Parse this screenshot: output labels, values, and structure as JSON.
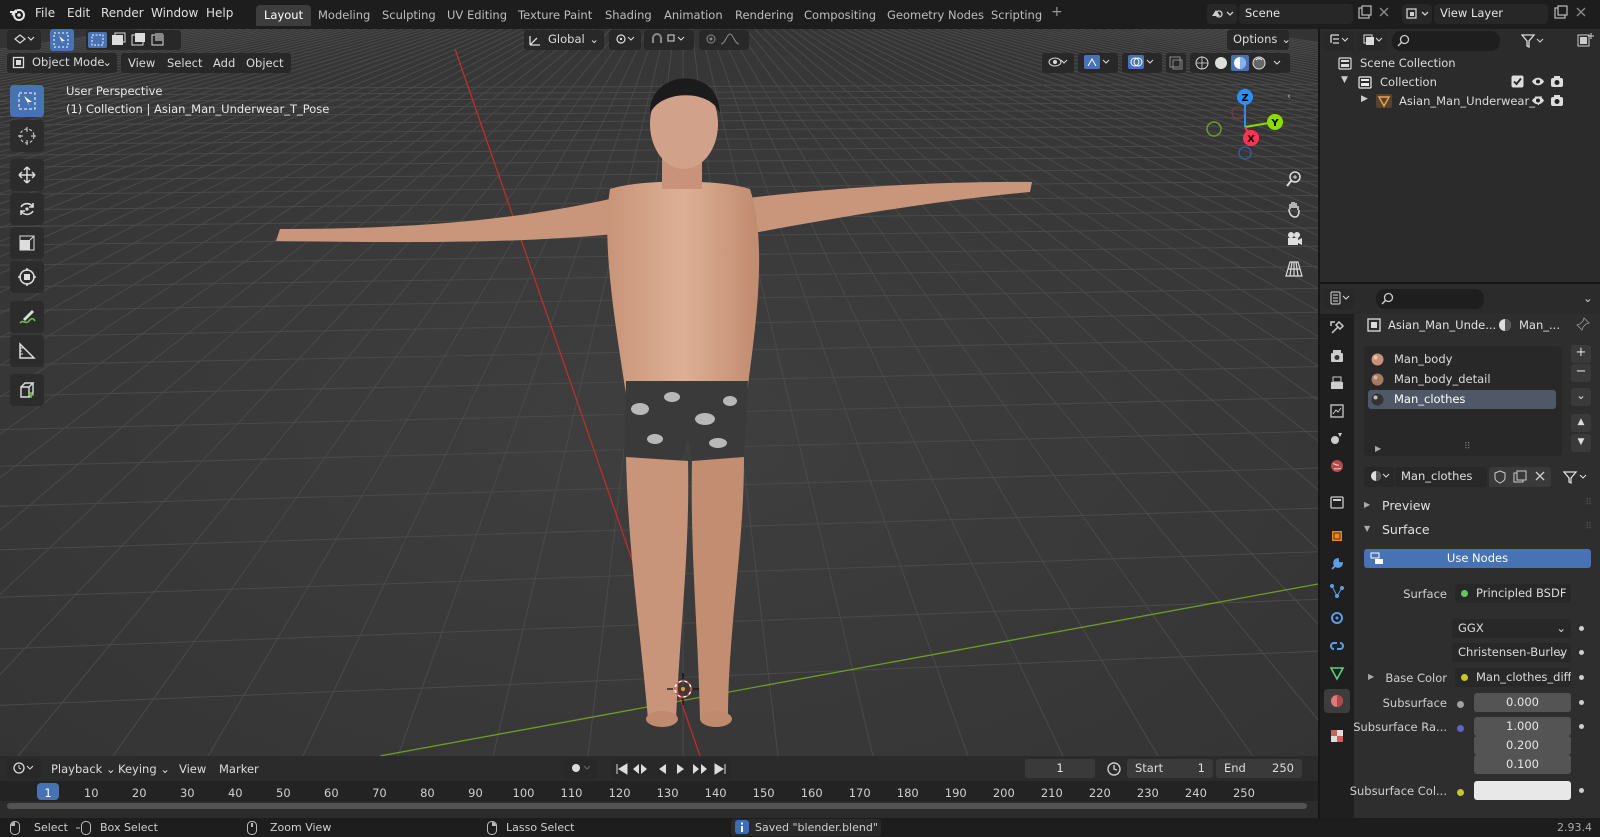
{
  "topbar": {
    "menus": [
      "File",
      "Edit",
      "Render",
      "Window",
      "Help"
    ],
    "workspaces": [
      "Layout",
      "Modeling",
      "Sculpting",
      "UV Editing",
      "Texture Paint",
      "Shading",
      "Animation",
      "Rendering",
      "Compositing",
      "Geometry Nodes",
      "Scripting"
    ],
    "add_tab": "+",
    "scene": "Scene",
    "view_layer": "View Layer"
  },
  "viewport_header": {
    "transform_orientation": "Global",
    "options": "Options",
    "mode": "Object Mode",
    "menus": [
      "View",
      "Select",
      "Add",
      "Object"
    ]
  },
  "viewport": {
    "perspective": "User Perspective",
    "collection_info": "(1) Collection | Asian_Man_Underwear_T_Pose",
    "gizmo": {
      "x": "X",
      "y": "Y",
      "z": "Z"
    }
  },
  "timeline": {
    "menus": [
      "Playback",
      "Keying",
      "View",
      "Marker"
    ],
    "current_frame": "1",
    "start_label": "Start",
    "start": "1",
    "end_label": "End",
    "end": "250",
    "frames": [
      "1",
      "10",
      "20",
      "30",
      "40",
      "50",
      "60",
      "70",
      "80",
      "90",
      "100",
      "110",
      "120",
      "130",
      "140",
      "150",
      "160",
      "170",
      "180",
      "190",
      "200",
      "210",
      "220",
      "230",
      "240",
      "250"
    ]
  },
  "statusbar": {
    "select": "Select",
    "box_select": "Box Select",
    "zoom_view": "Zoom View",
    "lasso_select": "Lasso Select",
    "message": "Saved \"blender.blend\"",
    "version": "2.93.4"
  },
  "outliner": {
    "scene_collection": "Scene Collection",
    "collection": "Collection",
    "object": "Asian_Man_Underwear_T"
  },
  "properties": {
    "object_name": "Asian_Man_Unde...",
    "material_short": "Man_...",
    "slots": [
      "Man_body",
      "Man_body_detail",
      "Man_clothes"
    ],
    "material_name": "Man_clothes",
    "panel_preview": "Preview",
    "panel_surface": "Surface",
    "use_nodes": "Use Nodes",
    "surface_label": "Surface",
    "surface_value": "Principled BSDF",
    "distribution": "GGX",
    "subsurface_method": "Christensen-Burley",
    "base_color_label": "Base Color",
    "base_color_value": "Man_clothes_diffus...",
    "subsurface_label": "Subsurface",
    "subsurface_value": "0.000",
    "subsurface_radius_label": "Subsurface Ra...",
    "subsurface_radius": [
      "1.000",
      "0.200",
      "0.100"
    ],
    "subsurface_color_label": "Subsurface Col..."
  },
  "colors": {
    "accent": "#4772b3",
    "x_axis": "#ff3352",
    "y_axis": "#8bdc00",
    "z_axis": "#2890ff"
  }
}
